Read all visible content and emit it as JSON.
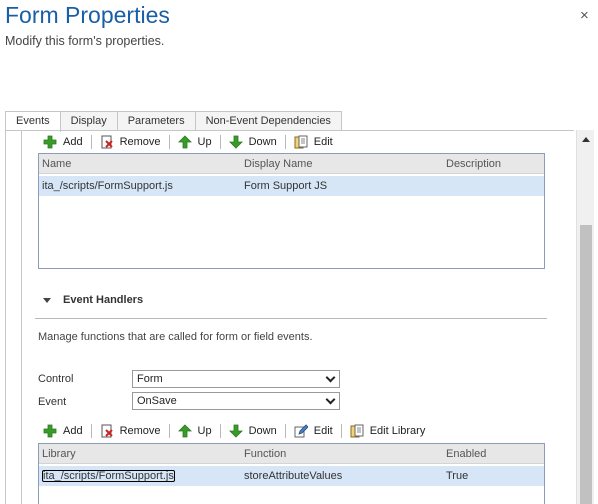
{
  "dialog": {
    "title": "Form Properties",
    "subtitle": "Modify this form's properties.",
    "close_glyph": "×"
  },
  "tabs": [
    {
      "label": "Events",
      "active": true
    },
    {
      "label": "Display",
      "active": false
    },
    {
      "label": "Parameters",
      "active": false
    },
    {
      "label": "Non-Event Dependencies",
      "active": false
    }
  ],
  "library_toolbar": {
    "add": "Add",
    "remove": "Remove",
    "up": "Up",
    "down": "Down",
    "edit": "Edit"
  },
  "library_grid": {
    "columns": [
      "Name",
      "Display Name",
      "Description"
    ],
    "rows": [
      {
        "name": "ita_/scripts/FormSupport.js",
        "display_name": "Form Support JS",
        "description": ""
      }
    ]
  },
  "event_handlers": {
    "title": "Event Handlers",
    "description": "Manage functions that are called for form or field events.",
    "control_label": "Control",
    "control_value": "Form",
    "event_label": "Event",
    "event_value": "OnSave"
  },
  "handler_toolbar": {
    "add": "Add",
    "remove": "Remove",
    "up": "Up",
    "down": "Down",
    "edit": "Edit",
    "edit_library": "Edit Library"
  },
  "handler_grid": {
    "columns": [
      "Library",
      "Function",
      "Enabled"
    ],
    "rows": [
      {
        "library": "ita_/scripts/FormSupport.js",
        "function": "storeAttributeValues",
        "enabled": "True"
      }
    ]
  },
  "colors": {
    "title": "#1a5ea6",
    "selected_row": "#d6e6f7",
    "grid_border": "#8c9dbc"
  }
}
